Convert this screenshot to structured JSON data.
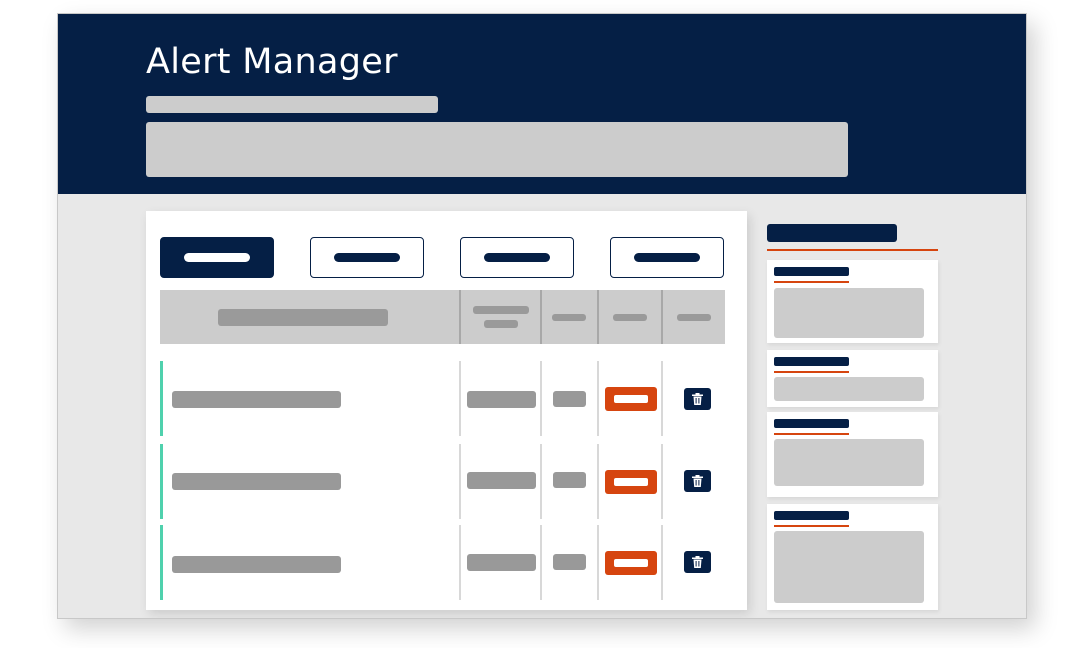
{
  "app": {
    "title": "Alert Manager"
  },
  "theme": {
    "primary": "#051f45",
    "accent": "#d6450f",
    "row_indicator": "#4fd1ad",
    "placeholder": "#cccccc"
  },
  "tabs": [
    {
      "state": "active"
    },
    {
      "state": "inactive"
    },
    {
      "state": "inactive"
    },
    {
      "state": "inactive"
    }
  ],
  "table": {
    "rows": [
      {
        "status": "alert",
        "action": "delete"
      },
      {
        "status": "alert",
        "action": "delete"
      },
      {
        "status": "alert",
        "action": "delete"
      }
    ],
    "row_icon": "trash-icon"
  },
  "sidebar": {
    "cards": [
      {
        "type": "summary"
      },
      {
        "type": "summary"
      },
      {
        "type": "summary"
      },
      {
        "type": "summary"
      }
    ]
  }
}
